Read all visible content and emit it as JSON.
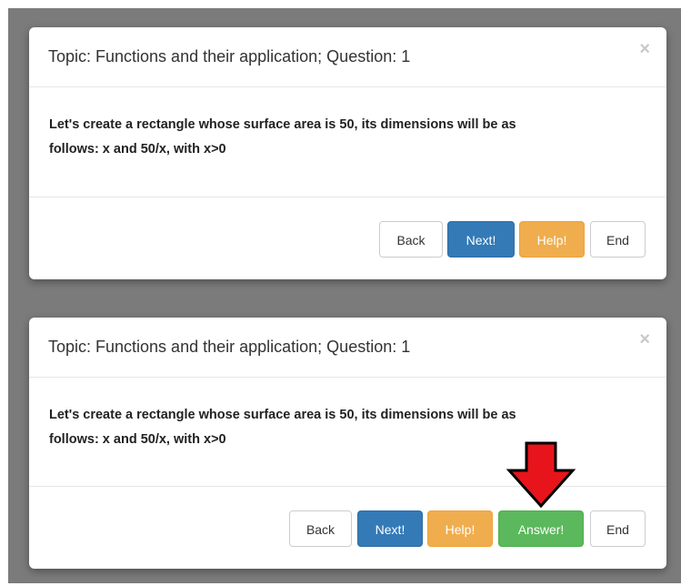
{
  "modals": [
    {
      "title": "Topic: Functions and their application; Question: 1",
      "close_symbol": "×",
      "body_line1": "Let's create a rectangle whose surface area is 50, its dimensions will be as",
      "body_line2": "follows: x and 50/x, with x>0",
      "buttons": {
        "back": "Back",
        "next": "Next!",
        "help": "Help!",
        "end": "End"
      }
    },
    {
      "title": "Topic: Functions and their application; Question: 1",
      "close_symbol": "×",
      "body_line1": "Let's create a rectangle whose surface area is 50, its dimensions will be as",
      "body_line2": "follows: x and 50/x, with x>0",
      "buttons": {
        "back": "Back",
        "next": "Next!",
        "help": "Help!",
        "answer": "Answer!",
        "end": "End"
      }
    }
  ],
  "colors": {
    "backdrop": "#7b7b7b",
    "primary": "#337ab7",
    "warning": "#f0ad4e",
    "success": "#5cb85c",
    "arrow": "#e8141b"
  },
  "annotation": {
    "icon": "arrow-down-icon"
  }
}
